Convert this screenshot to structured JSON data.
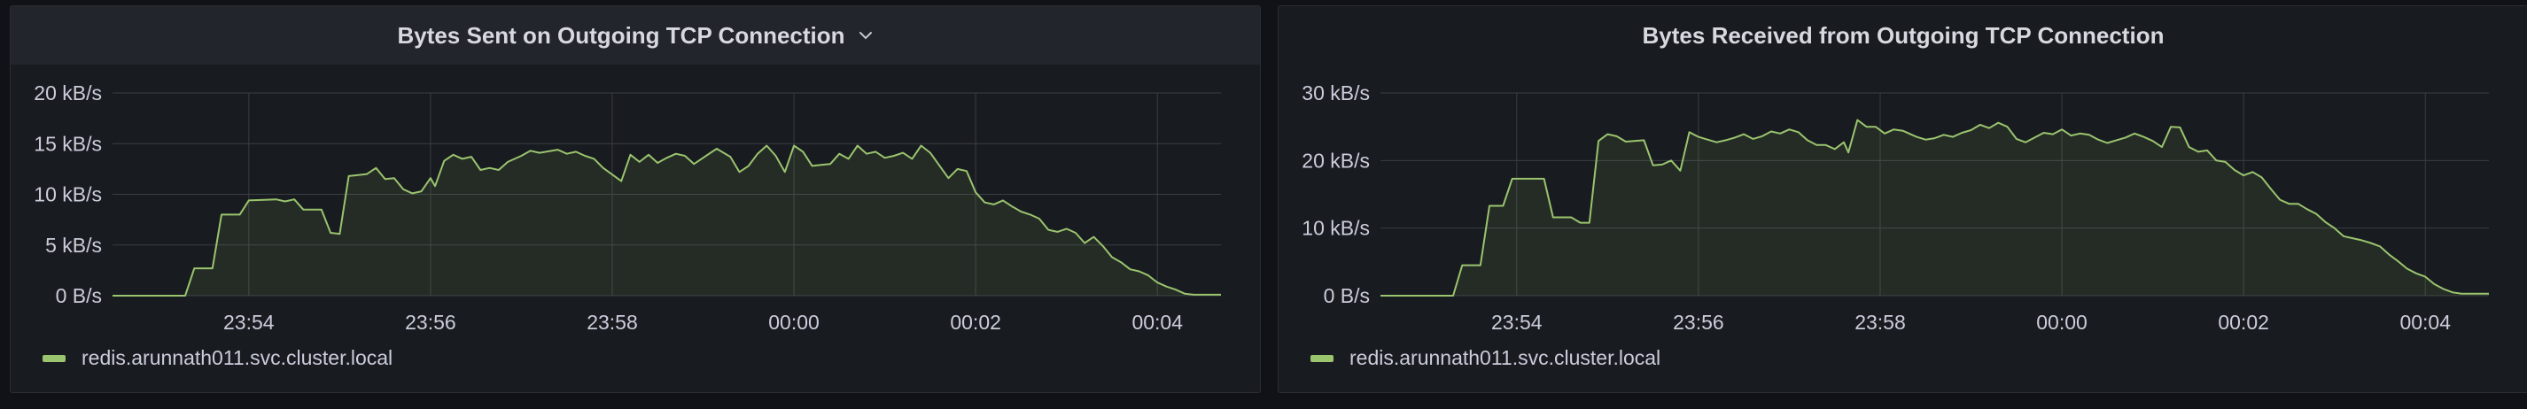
{
  "colors": {
    "background": "#111217",
    "panel": "#181b1f",
    "grid": "#3a3d44",
    "series": "#9ac46e"
  },
  "panels": [
    {
      "title": "Bytes Sent on Outgoing TCP Connection",
      "header_menu_icon": "chevron-down-icon",
      "legend": "redis.arunnath011.svc.cluster.local"
    },
    {
      "title": "Bytes Received from Outgoing TCP Connection",
      "legend": "redis.arunnath011.svc.cluster.local"
    }
  ],
  "chart_data": [
    {
      "type": "area",
      "title": "Bytes Sent on Outgoing TCP Connection",
      "ylim": [
        0,
        20
      ],
      "yticks": [
        {
          "v": 0,
          "label": "0 B/s"
        },
        {
          "v": 5,
          "label": "5 kB/s"
        },
        {
          "v": 10,
          "label": "10 kB/s"
        },
        {
          "v": 15,
          "label": "15 kB/s"
        },
        {
          "v": 20,
          "label": "20 kB/s"
        }
      ],
      "xlim": [
        -7.5,
        4.7
      ],
      "xticks": [
        {
          "v": -6,
          "label": "23:54"
        },
        {
          "v": -4,
          "label": "23:56"
        },
        {
          "v": -2,
          "label": "23:58"
        },
        {
          "v": 0,
          "label": "00:00"
        },
        {
          "v": 2,
          "label": "00:02"
        },
        {
          "v": 4,
          "label": "00:04"
        }
      ],
      "grid": true,
      "legend_position": "bottom-left",
      "series": [
        {
          "name": "redis.arunnath011.svc.cluster.local",
          "points": [
            [
              -7.5,
              0
            ],
            [
              -6.7,
              0
            ],
            [
              -6.6,
              2.7
            ],
            [
              -6.4,
              2.7
            ],
            [
              -6.3,
              8
            ],
            [
              -6.1,
              8
            ],
            [
              -6,
              9.4
            ],
            [
              -5.7,
              9.5
            ],
            [
              -5.6,
              9.3
            ],
            [
              -5.5,
              9.5
            ],
            [
              -5.4,
              8.5
            ],
            [
              -5.2,
              8.5
            ],
            [
              -5.1,
              6.2
            ],
            [
              -5,
              6.1
            ],
            [
              -4.9,
              11.8
            ],
            [
              -4.7,
              12
            ],
            [
              -4.6,
              12.6
            ],
            [
              -4.5,
              11.5
            ],
            [
              -4.4,
              11.6
            ],
            [
              -4.3,
              10.5
            ],
            [
              -4.2,
              10.1
            ],
            [
              -4.1,
              10.3
            ],
            [
              -4,
              11.6
            ],
            [
              -3.95,
              10.8
            ],
            [
              -3.85,
              13.3
            ],
            [
              -3.75,
              13.9
            ],
            [
              -3.65,
              13.5
            ],
            [
              -3.55,
              13.7
            ],
            [
              -3.45,
              12.4
            ],
            [
              -3.35,
              12.6
            ],
            [
              -3.25,
              12.4
            ],
            [
              -3.15,
              13.2
            ],
            [
              -3,
              13.8
            ],
            [
              -2.9,
              14.3
            ],
            [
              -2.8,
              14.1
            ],
            [
              -2.6,
              14.4
            ],
            [
              -2.5,
              14.0
            ],
            [
              -2.4,
              14.2
            ],
            [
              -2.3,
              13.8
            ],
            [
              -2.2,
              13.5
            ],
            [
              -2.1,
              12.6
            ],
            [
              -1.9,
              11.3
            ],
            [
              -1.8,
              13.9
            ],
            [
              -1.7,
              13.2
            ],
            [
              -1.6,
              13.9
            ],
            [
              -1.5,
              13.1
            ],
            [
              -1.4,
              13.6
            ],
            [
              -1.3,
              14.0
            ],
            [
              -1.2,
              13.8
            ],
            [
              -1.1,
              13.0
            ],
            [
              -0.95,
              13.9
            ],
            [
              -0.85,
              14.5
            ],
            [
              -0.7,
              13.7
            ],
            [
              -0.6,
              12.2
            ],
            [
              -0.5,
              12.8
            ],
            [
              -0.4,
              14.0
            ],
            [
              -0.3,
              14.8
            ],
            [
              -0.2,
              13.8
            ],
            [
              -0.1,
              12.2
            ],
            [
              0,
              14.8
            ],
            [
              0.1,
              14.2
            ],
            [
              0.2,
              12.8
            ],
            [
              0.3,
              12.9
            ],
            [
              0.4,
              13.0
            ],
            [
              0.5,
              14.0
            ],
            [
              0.6,
              13.5
            ],
            [
              0.7,
              14.8
            ],
            [
              0.8,
              14.0
            ],
            [
              0.9,
              14.2
            ],
            [
              1.0,
              13.6
            ],
            [
              1.1,
              13.8
            ],
            [
              1.2,
              14.1
            ],
            [
              1.3,
              13.5
            ],
            [
              1.4,
              14.8
            ],
            [
              1.5,
              14.1
            ],
            [
              1.7,
              11.6
            ],
            [
              1.8,
              12.5
            ],
            [
              1.9,
              12.3
            ],
            [
              2.0,
              10.2
            ],
            [
              2.1,
              9.2
            ],
            [
              2.2,
              9.0
            ],
            [
              2.3,
              9.4
            ],
            [
              2.4,
              8.8
            ],
            [
              2.5,
              8.3
            ],
            [
              2.6,
              8.0
            ],
            [
              2.7,
              7.6
            ],
            [
              2.8,
              6.5
            ],
            [
              2.9,
              6.3
            ],
            [
              3.0,
              6.6
            ],
            [
              3.1,
              6.2
            ],
            [
              3.2,
              5.2
            ],
            [
              3.3,
              5.8
            ],
            [
              3.4,
              4.9
            ],
            [
              3.5,
              3.8
            ],
            [
              3.6,
              3.3
            ],
            [
              3.7,
              2.6
            ],
            [
              3.8,
              2.4
            ],
            [
              3.9,
              2.0
            ],
            [
              4.0,
              1.3
            ],
            [
              4.1,
              0.9
            ],
            [
              4.2,
              0.6
            ],
            [
              4.3,
              0.2
            ],
            [
              4.4,
              0.1
            ],
            [
              4.7,
              0.1
            ]
          ]
        }
      ]
    },
    {
      "type": "area",
      "title": "Bytes Received from Outgoing TCP Connection",
      "ylim": [
        0,
        30
      ],
      "yticks": [
        {
          "v": 0,
          "label": "0 B/s"
        },
        {
          "v": 10,
          "label": "10 kB/s"
        },
        {
          "v": 20,
          "label": "20 kB/s"
        },
        {
          "v": 30,
          "label": "30 kB/s"
        }
      ],
      "xlim": [
        -7.5,
        4.7
      ],
      "xticks": [
        {
          "v": -6,
          "label": "23:54"
        },
        {
          "v": -4,
          "label": "23:56"
        },
        {
          "v": -2,
          "label": "23:58"
        },
        {
          "v": 0,
          "label": "00:00"
        },
        {
          "v": 2,
          "label": "00:02"
        },
        {
          "v": 4,
          "label": "00:04"
        }
      ],
      "grid": true,
      "legend_position": "bottom-left",
      "series": [
        {
          "name": "redis.arunnath011.svc.cluster.local",
          "points": [
            [
              -7.5,
              0
            ],
            [
              -6.7,
              0
            ],
            [
              -6.6,
              4.5
            ],
            [
              -6.4,
              4.5
            ],
            [
              -6.3,
              13.3
            ],
            [
              -6.15,
              13.3
            ],
            [
              -6.05,
              17.3
            ],
            [
              -5.7,
              17.3
            ],
            [
              -5.6,
              11.6
            ],
            [
              -5.4,
              11.6
            ],
            [
              -5.3,
              10.8
            ],
            [
              -5.2,
              10.8
            ],
            [
              -5.1,
              22.9
            ],
            [
              -5.0,
              23.9
            ],
            [
              -4.9,
              23.6
            ],
            [
              -4.8,
              22.8
            ],
            [
              -4.6,
              23.0
            ],
            [
              -4.5,
              19.3
            ],
            [
              -4.4,
              19.4
            ],
            [
              -4.3,
              20.0
            ],
            [
              -4.2,
              18.5
            ],
            [
              -4.1,
              24.2
            ],
            [
              -4.0,
              23.5
            ],
            [
              -3.9,
              23.1
            ],
            [
              -3.8,
              22.7
            ],
            [
              -3.7,
              23.0
            ],
            [
              -3.6,
              23.4
            ],
            [
              -3.5,
              23.9
            ],
            [
              -3.4,
              23.2
            ],
            [
              -3.3,
              23.6
            ],
            [
              -3.2,
              24.3
            ],
            [
              -3.1,
              24.0
            ],
            [
              -3.0,
              24.6
            ],
            [
              -2.9,
              24.2
            ],
            [
              -2.8,
              23.0
            ],
            [
              -2.7,
              22.3
            ],
            [
              -2.6,
              22.3
            ],
            [
              -2.5,
              21.7
            ],
            [
              -2.4,
              22.7
            ],
            [
              -2.35,
              21.2
            ],
            [
              -2.25,
              26.0
            ],
            [
              -2.15,
              25.0
            ],
            [
              -2.05,
              25.0
            ],
            [
              -1.95,
              24.0
            ],
            [
              -1.85,
              24.6
            ],
            [
              -1.75,
              24.4
            ],
            [
              -1.6,
              23.5
            ],
            [
              -1.5,
              23.1
            ],
            [
              -1.4,
              23.3
            ],
            [
              -1.3,
              23.8
            ],
            [
              -1.2,
              23.5
            ],
            [
              -1.1,
              24.1
            ],
            [
              -1.0,
              24.5
            ],
            [
              -0.9,
              25.3
            ],
            [
              -0.8,
              24.8
            ],
            [
              -0.7,
              25.6
            ],
            [
              -0.6,
              25.0
            ],
            [
              -0.5,
              23.2
            ],
            [
              -0.4,
              22.7
            ],
            [
              -0.3,
              23.4
            ],
            [
              -0.2,
              24.1
            ],
            [
              -0.1,
              23.9
            ],
            [
              0,
              24.6
            ],
            [
              0.1,
              23.7
            ],
            [
              0.2,
              24.0
            ],
            [
              0.3,
              23.8
            ],
            [
              0.4,
              23.1
            ],
            [
              0.5,
              22.6
            ],
            [
              0.6,
              23.0
            ],
            [
              0.7,
              23.4
            ],
            [
              0.8,
              24.0
            ],
            [
              0.9,
              23.5
            ],
            [
              1.0,
              22.9
            ],
            [
              1.1,
              22.0
            ],
            [
              1.2,
              25.0
            ],
            [
              1.3,
              24.9
            ],
            [
              1.4,
              22.0
            ],
            [
              1.5,
              21.3
            ],
            [
              1.6,
              21.5
            ],
            [
              1.7,
              20.0
            ],
            [
              1.8,
              19.8
            ],
            [
              1.9,
              18.6
            ],
            [
              2.0,
              17.8
            ],
            [
              2.1,
              18.3
            ],
            [
              2.2,
              17.5
            ],
            [
              2.3,
              15.8
            ],
            [
              2.4,
              14.2
            ],
            [
              2.5,
              13.6
            ],
            [
              2.6,
              13.6
            ],
            [
              2.7,
              12.8
            ],
            [
              2.8,
              12.1
            ],
            [
              2.9,
              10.9
            ],
            [
              3.0,
              10.0
            ],
            [
              3.1,
              8.8
            ],
            [
              3.2,
              8.5
            ],
            [
              3.3,
              8.2
            ],
            [
              3.4,
              7.8
            ],
            [
              3.5,
              7.3
            ],
            [
              3.6,
              6.1
            ],
            [
              3.7,
              5.1
            ],
            [
              3.8,
              4.0
            ],
            [
              3.9,
              3.3
            ],
            [
              4.0,
              2.8
            ],
            [
              4.1,
              1.7
            ],
            [
              4.2,
              1.0
            ],
            [
              4.3,
              0.5
            ],
            [
              4.4,
              0.3
            ],
            [
              4.7,
              0.3
            ]
          ]
        }
      ]
    }
  ]
}
